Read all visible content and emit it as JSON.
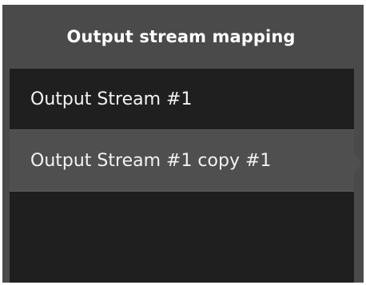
{
  "panel": {
    "title": "Output stream mapping"
  },
  "streams": [
    {
      "label": "Output Stream #1",
      "selected": false
    },
    {
      "label": "Output Stream #1 copy #1",
      "selected": true
    }
  ],
  "colors": {
    "panel_bg": "#4a4a4a",
    "list_bg": "#1f1f1f",
    "selected_bg": "#4f4f4f",
    "text": "#f2f2f2"
  }
}
